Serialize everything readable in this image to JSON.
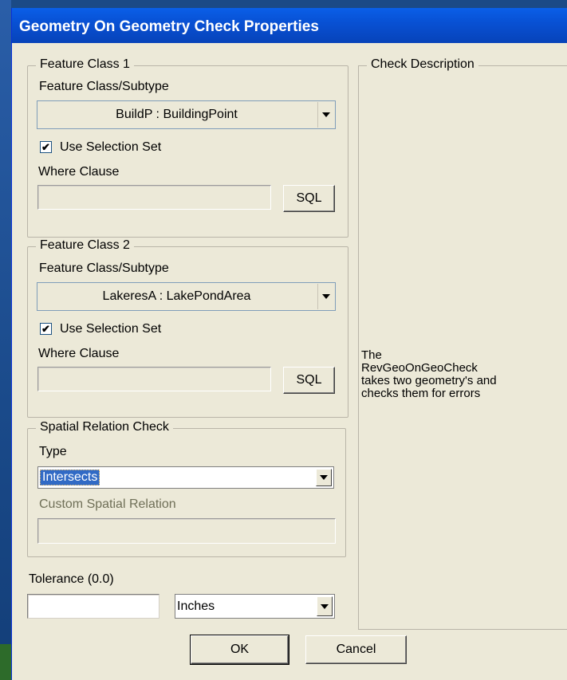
{
  "window": {
    "title": "Geometry On Geometry Check Properties"
  },
  "feature_class_1": {
    "legend": "Feature Class 1",
    "subtype_label": "Feature Class/Subtype",
    "subtype_value": "BuildP : BuildingPoint",
    "use_selection_label": "Use Selection Set",
    "use_selection_checked": true,
    "checkmark": "✔",
    "where_label": "Where Clause",
    "where_value": "",
    "sql_label": "SQL"
  },
  "feature_class_2": {
    "legend": "Feature Class 2",
    "subtype_label": "Feature Class/Subtype",
    "subtype_value": "LakeresA : LakePondArea",
    "use_selection_label": "Use Selection Set",
    "use_selection_checked": true,
    "checkmark": "✔",
    "where_label": "Where Clause",
    "where_value": "",
    "sql_label": "SQL"
  },
  "spatial_relation": {
    "legend": "Spatial Relation Check",
    "type_label": "Type",
    "type_value": "Intersects",
    "custom_label": "Custom Spatial Relation",
    "custom_value": ""
  },
  "tolerance": {
    "label": "Tolerance (0.0)",
    "value": "",
    "units_value": "Inches"
  },
  "check_description": {
    "legend": "Check Description",
    "text": "The\nRevGeoOnGeoCheck\ntakes two geometry's and\nchecks them for errors"
  },
  "buttons": {
    "ok_label": "OK",
    "cancel_label": "Cancel"
  },
  "colors": {
    "title_bar": "#0851d4",
    "dialog_bg": "#ece9d8",
    "selection": "#316ac5"
  }
}
